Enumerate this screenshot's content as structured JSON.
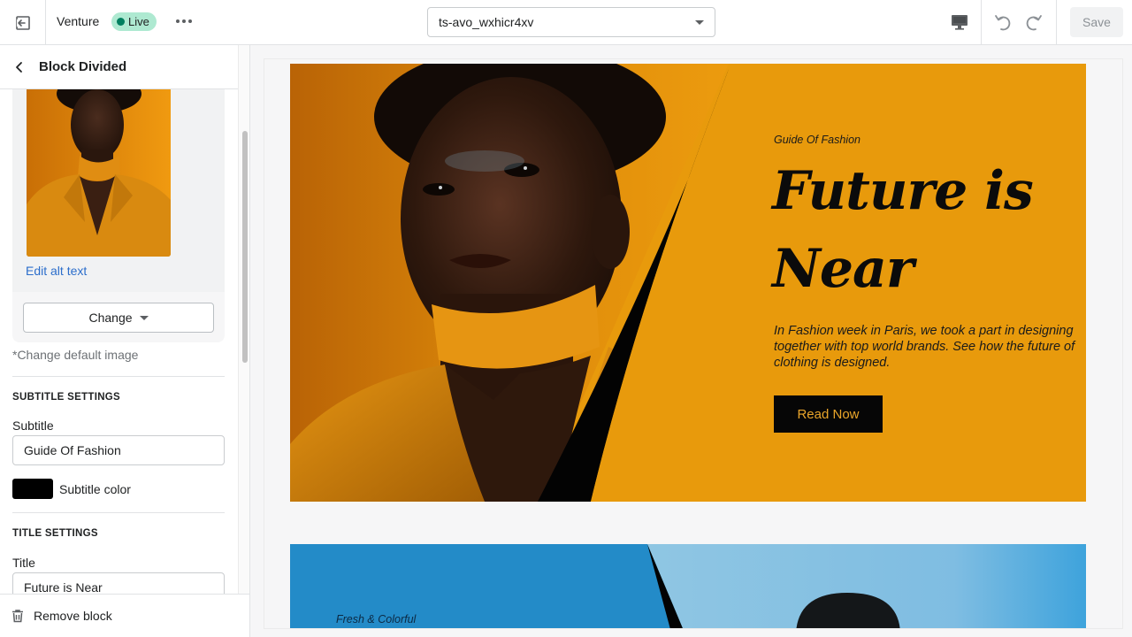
{
  "topbar": {
    "store_name": "Venture",
    "status_badge": "Live",
    "theme_select": {
      "value": "ts-avo_wxhicr4xv"
    },
    "save_label": "Save",
    "icons": {
      "exit": "exit-icon",
      "more": "more-horizontal-icon",
      "device": "desktop-icon",
      "undo": "undo-icon",
      "redo": "redo-icon"
    }
  },
  "sidebar": {
    "title": "Block Divided",
    "image": {
      "edit_alt_label": "Edit alt text",
      "change_label": "Change",
      "default_note": "*Change default image"
    },
    "subtitle_settings": {
      "heading": "SUBTITLE SETTINGS",
      "label": "Subtitle",
      "value": "Guide Of Fashion",
      "color_label": "Subtitle color",
      "color": "#000000"
    },
    "title_settings": {
      "heading": "TITLE SETTINGS",
      "label": "Title",
      "value": "Future is Near"
    },
    "remove_label": "Remove block"
  },
  "preview": {
    "banner1": {
      "subtitle": "Guide Of Fashion",
      "title_line1": "Future is",
      "title_line2": "Near",
      "description": "In Fashion week in Paris, we took a part in designing together with top world brands. See how the future of clothing is designed.",
      "button_label": "Read Now",
      "background": "#e89a0c",
      "button_text_color": "#e9a52a"
    },
    "banner2": {
      "subtitle": "Fresh & Colorful",
      "background": "#238bc8"
    }
  },
  "colors": {
    "accent_link": "#2c6ecb",
    "live_badge": "#aee9d1",
    "live_dot": "#007f5f"
  }
}
